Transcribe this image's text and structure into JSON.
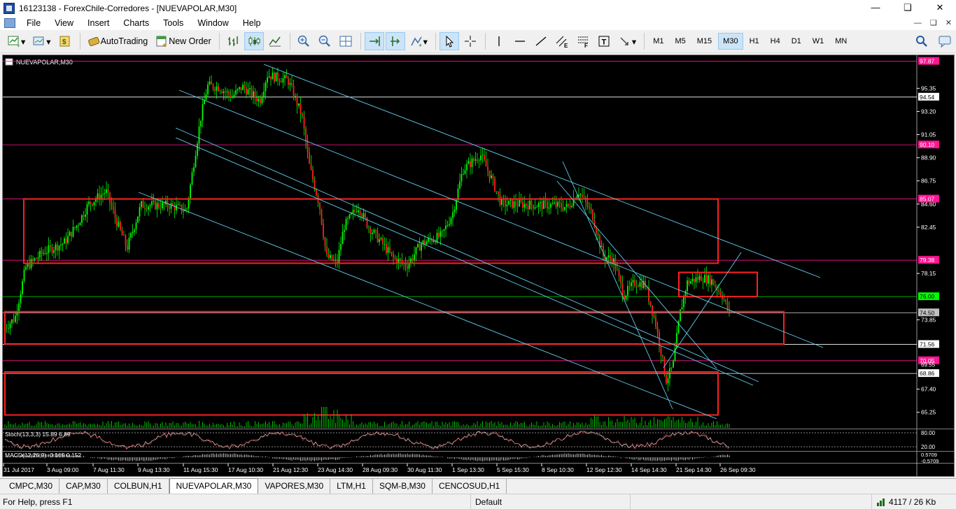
{
  "window": {
    "title": "16123138 - ForexChile-Corredores - [NUEVAPOLAR,M30]"
  },
  "menu": [
    "File",
    "View",
    "Insert",
    "Charts",
    "Tools",
    "Window",
    "Help"
  ],
  "toolbar": {
    "autotrading": "AutoTrading",
    "neworder": "New Order"
  },
  "timeframes": [
    "M1",
    "M5",
    "M15",
    "M30",
    "H1",
    "H4",
    "D1",
    "W1",
    "MN"
  ],
  "active_timeframe": "M30",
  "chart": {
    "symbol_label": "NUEVAPOLAR,M30",
    "price_ticks": [
      "95.35",
      "93.20",
      "91.05",
      "88.90",
      "86.75",
      "84.60",
      "82.45",
      "78.15",
      "73.85",
      "67.40",
      "65.25"
    ],
    "level_labels": [
      {
        "text": "97.87",
        "color": "#ff1493"
      },
      {
        "text": "94.54",
        "color": "#ffffff"
      },
      {
        "text": "90.10",
        "color": "#ff1493"
      },
      {
        "text": "85.07",
        "color": "#ff1493"
      },
      {
        "text": "79.38",
        "color": "#ff1493"
      },
      {
        "text": "76.00",
        "color": "#00ff00"
      },
      {
        "text": "74.50",
        "color": "#c0c0c0"
      },
      {
        "text": "71.56",
        "color": "#ffffff"
      },
      {
        "text": "70.05",
        "color": "#ff1493"
      },
      {
        "text": "69.55",
        "color": "#ffffff"
      },
      {
        "text": "68.86",
        "color": "#ffffff"
      }
    ],
    "time_labels": [
      "31 Jul 2017",
      "3 Aug 09:00",
      "7 Aug 11:30",
      "9 Aug 13:30",
      "11 Aug 15:30",
      "17 Aug 10:30",
      "21 Aug 12:30",
      "23 Aug 14:30",
      "28 Aug 09:30",
      "30 Aug 11:30",
      "1 Sep 13:30",
      "5 Sep 15:30",
      "8 Sep 10:30",
      "12 Sep 12:30",
      "14 Sep 14:30",
      "21 Sep 14:30",
      "26 Sep 09:30"
    ],
    "stoch": {
      "label": "Stoch(13,3,3) 15.89 6.89",
      "ticks": [
        "80.00",
        "20.00"
      ]
    },
    "macd": {
      "label": "MACD(12,26,9) -0.169 0.152",
      "ticks": [
        "0.5709",
        "-0.5709"
      ]
    }
  },
  "chart_tabs": [
    "CMPC,M30",
    "CAP,M30",
    "COLBUN,H1",
    "NUEVAPOLAR,M30",
    "VAPORES,M30",
    "LTM,H1",
    "SQM-B,M30",
    "CENCOSUD,H1"
  ],
  "active_tab": "NUEVAPOLAR,M30",
  "status": {
    "help": "For Help, press F1",
    "profile": "Default",
    "traffic": "4117 / 26 Kb"
  }
}
